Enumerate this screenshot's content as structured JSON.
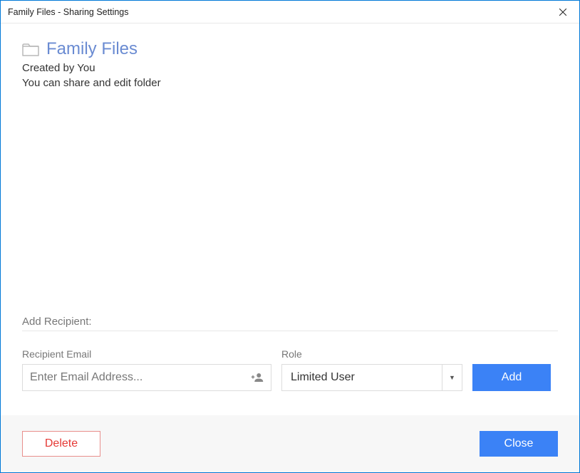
{
  "titlebar": {
    "title": "Family Files - Sharing Settings"
  },
  "header": {
    "folder_name": "Family Files",
    "created_by": "Created by You",
    "permissions_line": "You can share and edit folder"
  },
  "add_recipient": {
    "section_title": "Add Recipient:",
    "email_label": "Recipient Email",
    "email_placeholder": "Enter Email Address...",
    "email_value": "",
    "role_label": "Role",
    "role_selected": "Limited User",
    "add_button": "Add"
  },
  "footer": {
    "delete_button": "Delete",
    "close_button": "Close"
  }
}
